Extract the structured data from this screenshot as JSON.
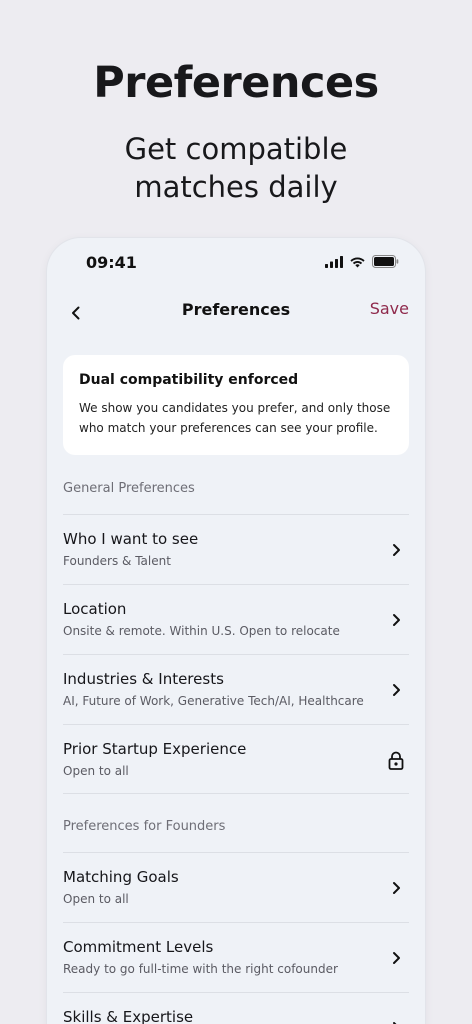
{
  "hero": {
    "title": "Preferences",
    "subtitle": "Get compatible matches daily"
  },
  "status_bar": {
    "time": "09:41"
  },
  "nav": {
    "title": "Preferences",
    "save_label": "Save",
    "back_icon": "chevron-left-icon"
  },
  "info_card": {
    "title": "Dual compatibility enforced",
    "body": "We show you candidates you prefer, and only those who match your preferences can see your profile."
  },
  "sections": [
    {
      "header": "General Preferences",
      "rows": [
        {
          "title": "Who I want to see",
          "subtitle": "Founders & Talent",
          "icon": "chevron-right-icon"
        },
        {
          "title": "Location",
          "subtitle": "Onsite & remote. Within U.S. Open to relocate",
          "icon": "chevron-right-icon"
        },
        {
          "title": "Industries & Interests",
          "subtitle": "AI, Future of Work, Generative Tech/AI, Healthcare",
          "icon": "chevron-right-icon"
        },
        {
          "title": "Prior Startup Experience",
          "subtitle": "Open to all",
          "icon": "lock-icon"
        }
      ]
    },
    {
      "header": "Preferences for Founders",
      "rows": [
        {
          "title": "Matching Goals",
          "subtitle": "Open to all",
          "icon": "chevron-right-icon"
        },
        {
          "title": "Commitment Levels",
          "subtitle": "Ready to go full-time with the right cofounder",
          "icon": "chevron-right-icon"
        },
        {
          "title": "Skills & Expertise",
          "subtitle": "",
          "icon": "chevron-right-icon"
        }
      ]
    }
  ],
  "colors": {
    "background": "#edecf1",
    "phone_bg": "#eff2f7",
    "accent_save": "#8f2a4c"
  }
}
